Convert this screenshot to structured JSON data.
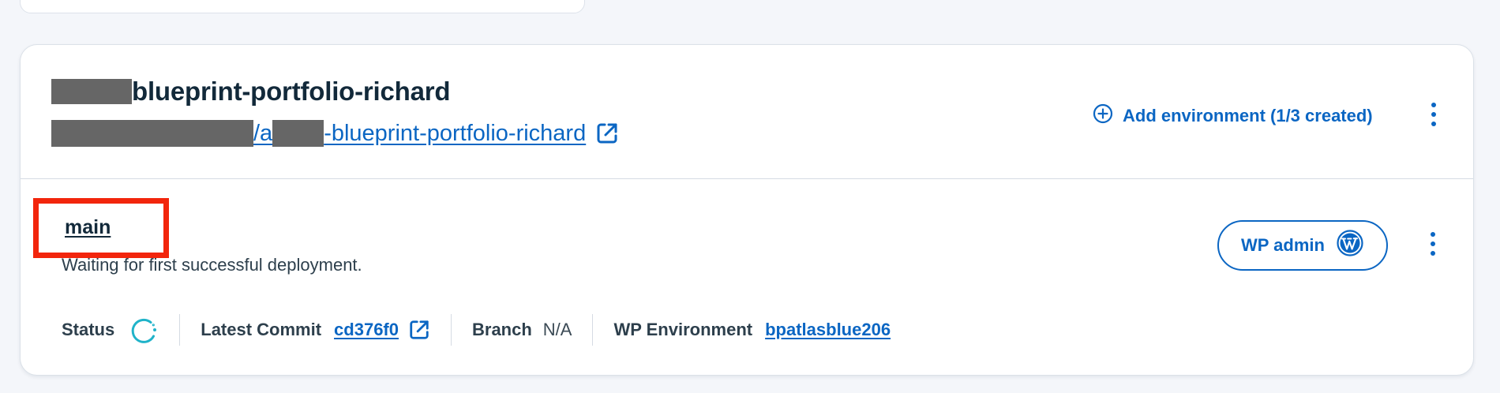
{
  "site": {
    "title": "blueprint-portfolio-richard",
    "repo_sep": "/a",
    "repo_link_suffix": "-blueprint-portfolio-richard",
    "add_environment_label": "Add environment (1/3 created)"
  },
  "environment": {
    "name": "main",
    "description": "Waiting for first successful deployment.",
    "wp_admin_label": "WP admin",
    "status_label": "Status",
    "latest_commit_label": "Latest Commit",
    "latest_commit_value": "cd376f0",
    "branch_label": "Branch",
    "branch_value": "N/A",
    "wp_environment_label": "WP Environment",
    "wp_environment_value": "bpatlasblue206"
  },
  "colors": {
    "accent": "#0b66c3",
    "highlight": "#f2250c",
    "spinner": "#20b3c9",
    "redaction": "#666666"
  },
  "icons": {
    "external_link": "external-link-icon",
    "add": "plus-circle-icon",
    "more": "kebab-menu-icon",
    "wordpress": "wordpress-icon",
    "status": "loading-spinner-icon"
  }
}
